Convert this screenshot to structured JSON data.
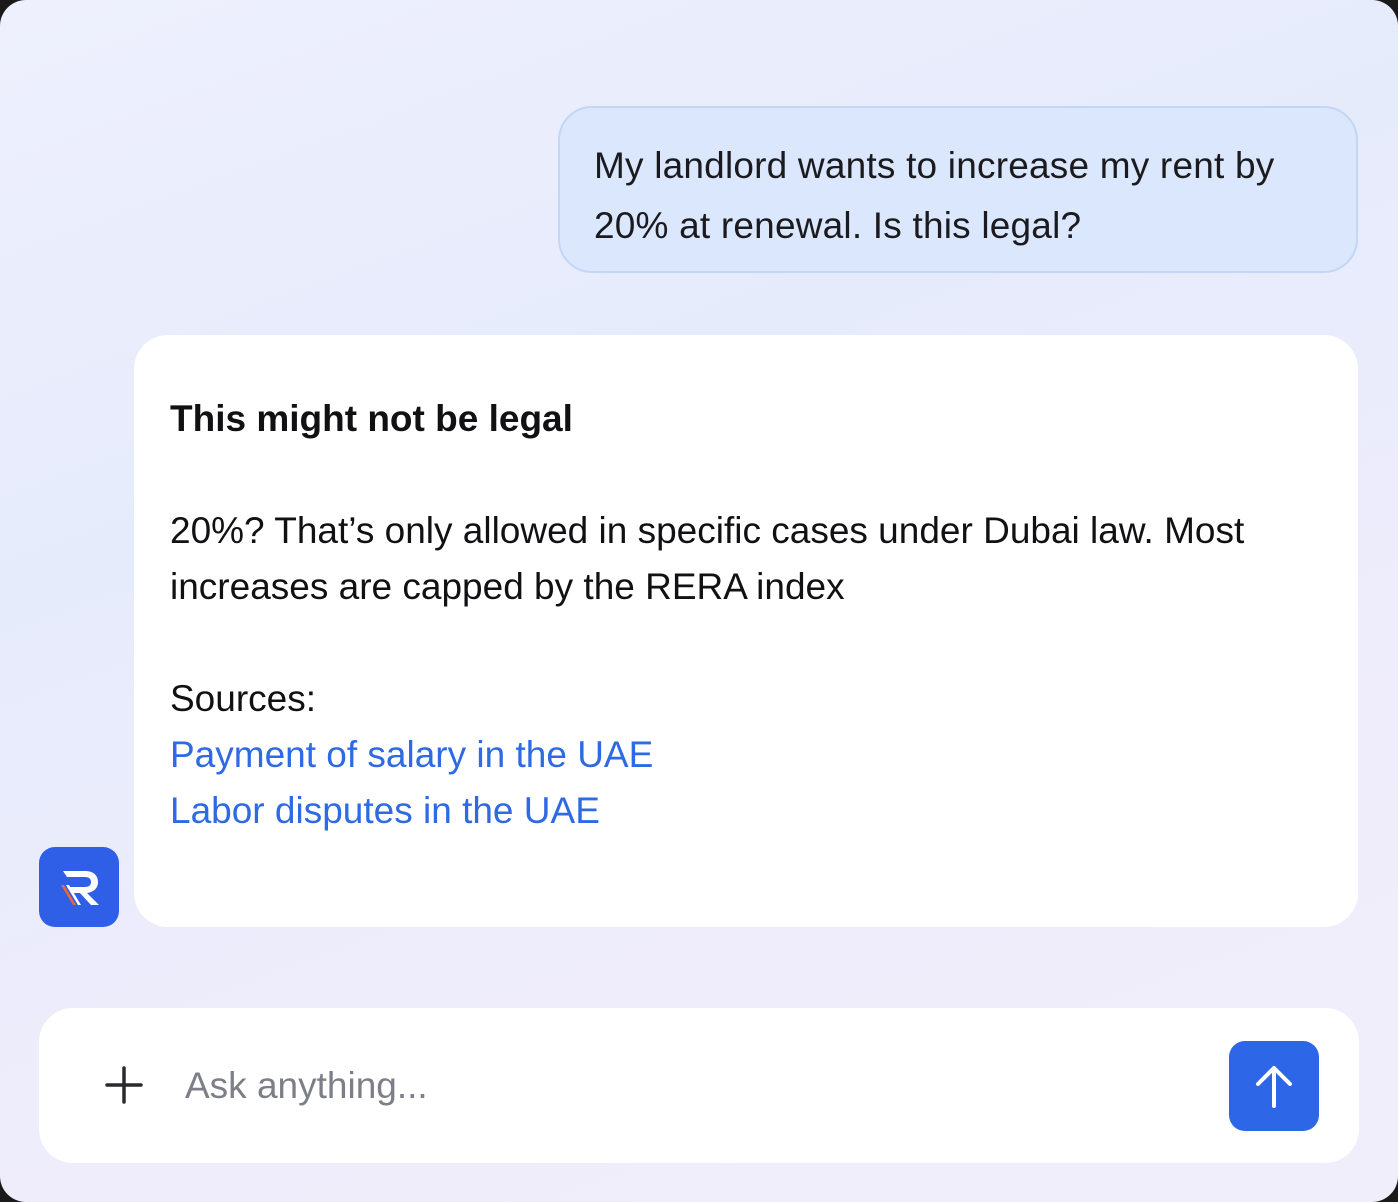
{
  "conversation": {
    "user_message": "My landlord wants to increase my rent by 20% at renewal. Is this legal?",
    "assistant": {
      "title": "This might not be legal",
      "body": "20%? That’s only allowed in specific cases under Dubai law. Most increases are capped by the RERA index",
      "sources_label": "Sources:",
      "sources": [
        {
          "label": "Payment of salary in the UAE"
        },
        {
          "label": "Labor disputes in the UAE"
        }
      ],
      "avatar_icon": "r-logo-icon"
    }
  },
  "composer": {
    "placeholder": "Ask anything...",
    "value": "",
    "add_icon": "plus-icon",
    "send_icon": "arrow-up-icon"
  },
  "colors": {
    "accent": "#2e66e8",
    "link": "#2d6ae3",
    "user_bubble": "#dbe7fd",
    "logo_stripe": "#f0643c"
  }
}
